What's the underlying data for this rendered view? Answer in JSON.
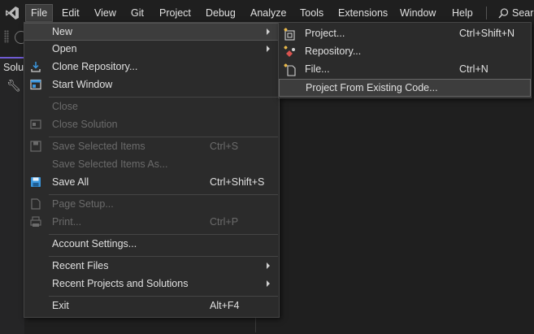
{
  "menubar": {
    "items": [
      "File",
      "Edit",
      "View",
      "Git",
      "Project",
      "Debug",
      "Analyze",
      "Tools",
      "Extensions",
      "Window",
      "Help"
    ],
    "search_label": "Search",
    "active": "File"
  },
  "left_panel": {
    "tab_label": "Solu"
  },
  "file_menu": {
    "items": [
      {
        "label": "New",
        "submenu": true,
        "state": "hover",
        "icon": ""
      },
      {
        "label": "Open",
        "submenu": true,
        "icon": ""
      },
      {
        "label": "Clone Repository...",
        "icon": "clone-repository-icon"
      },
      {
        "label": "Start Window",
        "icon": "start-window-icon"
      },
      {
        "label": "Close",
        "disabled": true,
        "icon": ""
      },
      {
        "label": "Close Solution",
        "disabled": true,
        "icon": "close-solution-icon"
      },
      {
        "label": "Save Selected Items",
        "shortcut": "Ctrl+S",
        "disabled": true,
        "icon": "save-icon"
      },
      {
        "label": "Save Selected Items As...",
        "disabled": true,
        "icon": ""
      },
      {
        "label": "Save All",
        "shortcut": "Ctrl+Shift+S",
        "icon": "save-all-icon"
      },
      {
        "label": "Page Setup...",
        "disabled": true,
        "icon": "page-setup-icon"
      },
      {
        "label": "Print...",
        "shortcut": "Ctrl+P",
        "disabled": true,
        "icon": "print-icon"
      },
      {
        "label": "Account Settings...",
        "icon": ""
      },
      {
        "label": "Recent Files",
        "submenu": true,
        "icon": ""
      },
      {
        "label": "Recent Projects and Solutions",
        "submenu": true,
        "icon": ""
      },
      {
        "label": "Exit",
        "shortcut": "Alt+F4",
        "icon": ""
      }
    ]
  },
  "new_submenu": {
    "items": [
      {
        "label": "Project...",
        "shortcut": "Ctrl+Shift+N",
        "icon": "new-project-icon"
      },
      {
        "label": "Repository...",
        "icon": "new-repository-icon"
      },
      {
        "label": "File...",
        "shortcut": "Ctrl+N",
        "icon": "new-file-icon"
      },
      {
        "label": "Project From Existing Code...",
        "state": "hover",
        "icon": ""
      }
    ]
  },
  "colors": {
    "accent": "#6f5bd3",
    "save_icon": "#3a96dd",
    "clone_icon": "#3a96dd"
  }
}
